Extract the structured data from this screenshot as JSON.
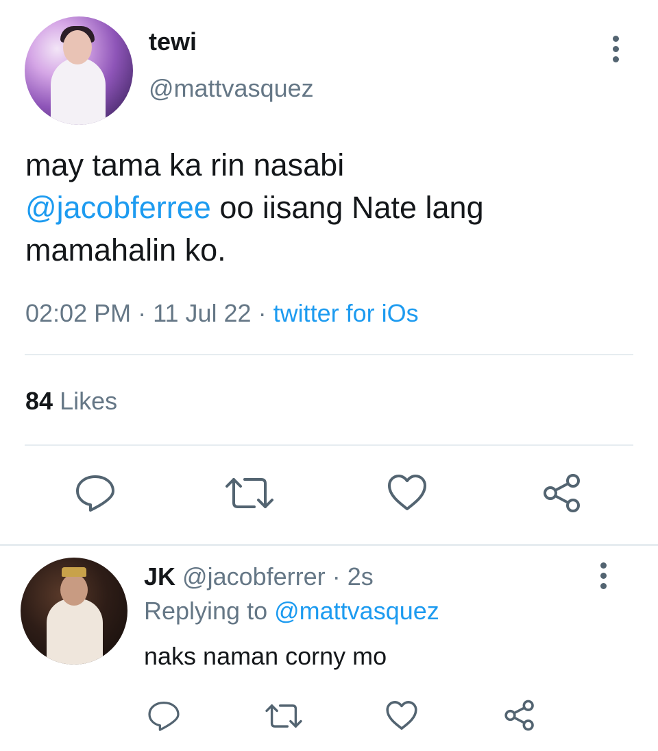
{
  "tweet": {
    "display_name": "tewi",
    "handle": "@mattvasquez",
    "text_part1": "may tama ka rin nasabi",
    "mention": "@jacobferree",
    "text_part2": " oo iisang Nate lang",
    "text_part3": "mamahalin ko.",
    "time": "02:02 PM",
    "date": "11 Jul 22",
    "source": "twitter for iOs",
    "likes_count": "84",
    "likes_label": "Likes"
  },
  "reply": {
    "display_name": "JK",
    "handle": "@jacobferrer",
    "age": "2s",
    "replying_label": "Replying to",
    "replying_to": "@mattvasquez",
    "text": "naks naman corny mo"
  },
  "icons": {
    "more": "more-vertical-icon",
    "reply": "comment-icon",
    "retweet": "retweet-icon",
    "like": "heart-icon",
    "share": "share-icon"
  },
  "colors": {
    "link": "#1d9bf0",
    "secondary_text": "#657786",
    "primary_text": "#14171a",
    "icon": "#536471",
    "divider": "#e6ecf0"
  }
}
